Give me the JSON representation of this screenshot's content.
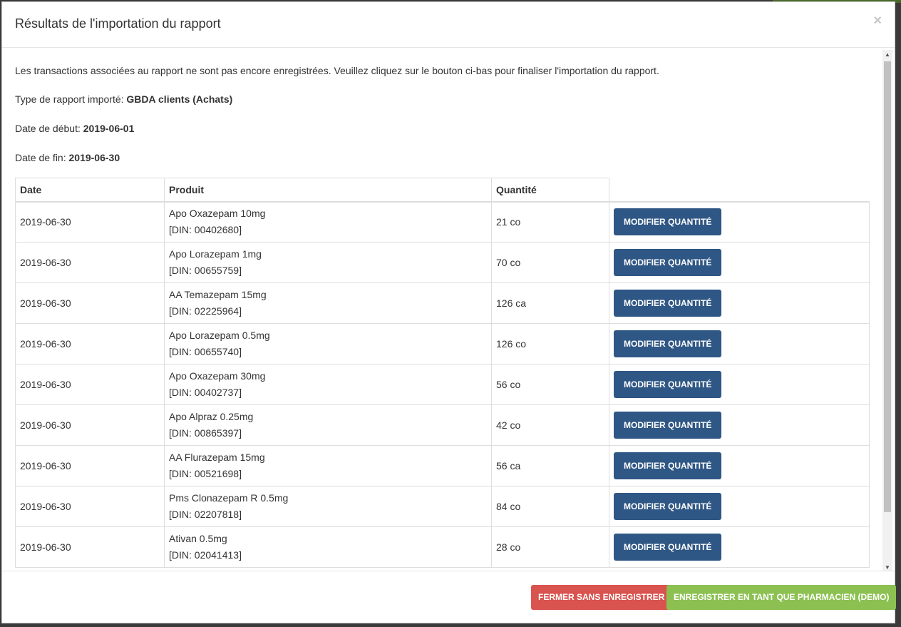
{
  "modal": {
    "title": "Résultats de l'importation du rapport",
    "close_symbol": "×"
  },
  "body": {
    "notice": "Les transactions associées au rapport ne sont pas encore enregistrées. Veuillez cliquez sur le bouton ci-bas pour finaliser l'importation du rapport.",
    "report_type_label": "Type de rapport importé: ",
    "report_type_value": "GBDA clients (Achats)",
    "start_date_label": "Date de début: ",
    "start_date_value": "2019-06-01",
    "end_date_label": "Date de fin: ",
    "end_date_value": "2019-06-30"
  },
  "table": {
    "headers": {
      "date": "Date",
      "product": "Produit",
      "quantity": "Quantité"
    },
    "button_label": "MODIFIER QUANTITÉ",
    "rows": [
      {
        "date": "2019-06-30",
        "product": "Apo Oxazepam 10mg",
        "din": "[DIN: 00402680]",
        "quantity": "21 co"
      },
      {
        "date": "2019-06-30",
        "product": "Apo Lorazepam 1mg",
        "din": "[DIN: 00655759]",
        "quantity": "70 co"
      },
      {
        "date": "2019-06-30",
        "product": "AA Temazepam 15mg",
        "din": "[DIN: 02225964]",
        "quantity": "126 ca"
      },
      {
        "date": "2019-06-30",
        "product": "Apo Lorazepam 0.5mg",
        "din": "[DIN: 00655740]",
        "quantity": "126 co"
      },
      {
        "date": "2019-06-30",
        "product": "Apo Oxazepam 30mg",
        "din": "[DIN: 00402737]",
        "quantity": "56 co"
      },
      {
        "date": "2019-06-30",
        "product": "Apo Alpraz 0.25mg",
        "din": "[DIN: 00865397]",
        "quantity": "42 co"
      },
      {
        "date": "2019-06-30",
        "product": "AA Flurazepam 15mg",
        "din": "[DIN: 00521698]",
        "quantity": "56 ca"
      },
      {
        "date": "2019-06-30",
        "product": "Pms Clonazepam R 0.5mg",
        "din": "[DIN: 02207818]",
        "quantity": "84 co"
      },
      {
        "date": "2019-06-30",
        "product": "Ativan 0.5mg",
        "din": "[DIN: 02041413]",
        "quantity": "28 co"
      }
    ]
  },
  "footer": {
    "close_without_save": "FERMER SANS ENREGISTRER",
    "save_as_pharmacist": "ENREGISTRER EN TANT QUE PHARMACIEN (DEMO)"
  },
  "colors": {
    "modify_button": "#2f5785",
    "danger_button": "#d9534f",
    "success_button": "#8cc152"
  }
}
